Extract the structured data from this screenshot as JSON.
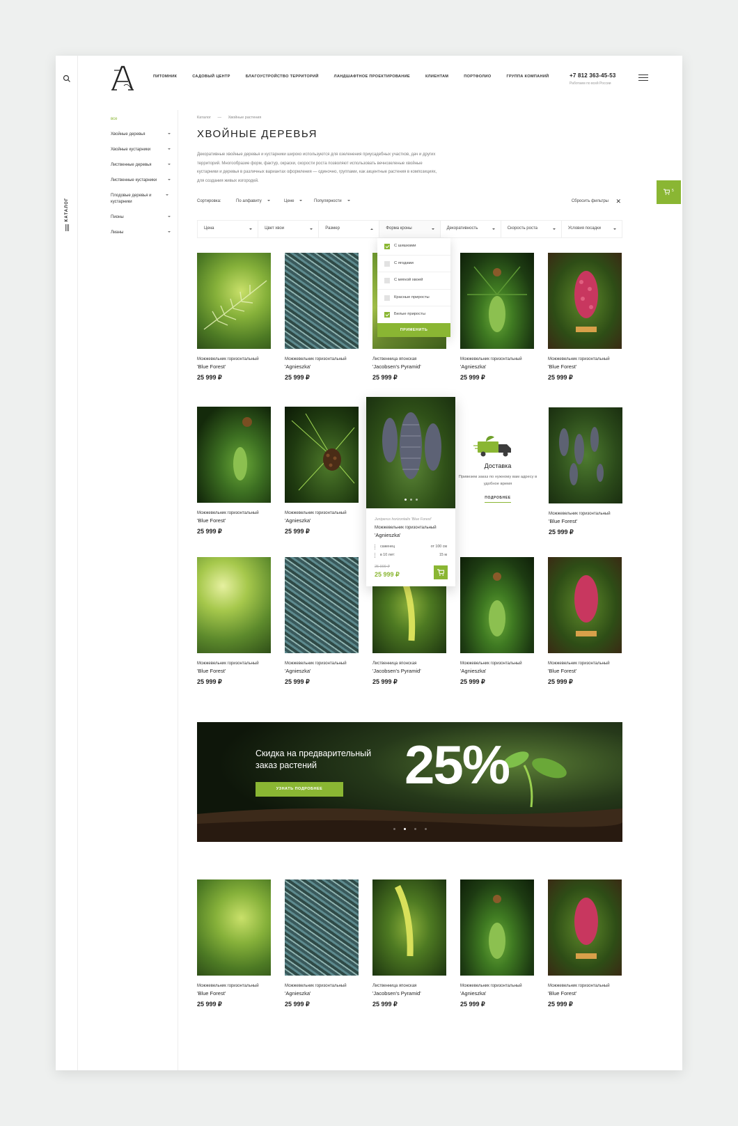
{
  "nav": {
    "items": [
      "ПИТОМНИК",
      "САДОВЫЙ ЦЕНТР",
      "БЛАГОУСТРОЙСТВО ТЕРРИТОРИЙ",
      "ЛАНДШАФТНОЕ ПРОЕКТИРОВАНИЕ",
      "КЛИЕНТАМ",
      "ПОРТФОЛИО",
      "ГРУППА КОМПАНИЙ"
    ],
    "phone": "+7 812 363-45-53",
    "phone_sub": "Работаем по всей России"
  },
  "rail": {
    "catalog_label": "КАТАЛОГ"
  },
  "sidebar": {
    "all": "все",
    "items": [
      "Хвойные деревья",
      "Хвойные кустарники",
      "Лиственные деревья",
      "Лиственные кустарники",
      "Плодовые деревья и кустарники",
      "Пионы",
      "Лианы"
    ]
  },
  "breadcrumb": {
    "root": "Каталог",
    "sep": "—",
    "current": "Хвойные растения"
  },
  "page": {
    "title": "ХВОЙНЫЕ ДЕРЕВЬЯ",
    "description": "Декоративные хвойные деревья и кустарники широко используются для озеленения приусадебных участков, дач и других территорий. Многообразие форм, фактур, окраски, скорости роста позволяют использовать вечнозеленые хвойные кустарники и деревья в различных вариантах оформления — одиночно, группами, как акцентные растения в композициях, для создания живых изгородей."
  },
  "sort": {
    "label": "Сортировка:",
    "options": [
      "По алфавиту",
      "Цене",
      "Популярности"
    ],
    "reset": "Сбросить фильтры",
    "reset_x": "✕"
  },
  "filters": [
    "Цена",
    "Цвет хвои",
    "Размер",
    "Форма кроны",
    "Декоративность",
    "Скорость роста",
    "Условия посадки"
  ],
  "dropdown": {
    "options": [
      {
        "label": "С шишками",
        "checked": true
      },
      {
        "label": "С ягодами",
        "checked": false
      },
      {
        "label": "С мягкой хвоей",
        "checked": false
      },
      {
        "label": "Красные приросты",
        "checked": false
      },
      {
        "label": "Белые приросты",
        "checked": true
      }
    ],
    "apply": "ПРИМЕНИТЬ"
  },
  "cart": {
    "count": "5"
  },
  "products": {
    "r1": [
      {
        "type": "Можжевельник горизонтальный",
        "name": "'Blue Forest'",
        "price": "25 999 ₽"
      },
      {
        "type": "Можжевельник горизонтальный",
        "name": "'Agnieszka'",
        "price": "25 999 ₽"
      },
      {
        "type": "Лиственница японская",
        "name": "'Jacobsen's Pyramid'",
        "price": "25 999 ₽"
      },
      {
        "type": "Можжевельник горизонтальный",
        "name": "'Agnieszka'",
        "price": "25 999 ₽"
      },
      {
        "type": "Можжевельник горизонтальный",
        "name": "'Blue Forest'",
        "price": "25 999 ₽"
      }
    ],
    "r2": [
      {
        "type": "Можжевельник горизонтальный",
        "name": "'Blue Forest'",
        "price": "25 999 ₽"
      },
      {
        "type": "Можжевельник горизонтальный",
        "name": "'Agnieszka'",
        "price": "25 999 ₽"
      },
      {
        "type": "Можжевельник горизонтальный",
        "name": "'Blue Forest'",
        "price": "25 999 ₽"
      }
    ],
    "r3": [
      {
        "type": "Можжевельник горизонтальный",
        "name": "'Blue Forest'",
        "price": "25 999 ₽"
      },
      {
        "type": "Можжевельник горизонтальный",
        "name": "'Agnieszka'",
        "price": "25 999 ₽"
      },
      {
        "type": "Лиственница японская",
        "name": "'Jacobsen's Pyramid'",
        "price": "25 999 ₽"
      },
      {
        "type": "Можжевельник горизонтальный",
        "name": "'Agnieszka'",
        "price": "25 999 ₽"
      },
      {
        "type": "Можжевельник горизонтальный",
        "name": "'Blue Forest'",
        "price": "25 999 ₽"
      }
    ],
    "r4": [
      {
        "type": "Можжевельник горизонтальный",
        "name": "'Blue Forest'",
        "price": "25 999 ₽"
      },
      {
        "type": "Можжевельник горизонтальный",
        "name": "'Agnieszka'",
        "price": "25 999 ₽"
      },
      {
        "type": "Лиственница японская",
        "name": "'Jacobsen's Pyramid'",
        "price": "25 999 ₽"
      },
      {
        "type": "Можжевельник горизонтальный",
        "name": "'Agnieszka'",
        "price": "25 999 ₽"
      },
      {
        "type": "Можжевельник горизонтальный",
        "name": "'Blue Forest'",
        "price": "25 999 ₽"
      }
    ]
  },
  "featured": {
    "latin": "Juniperus horizontalis 'Blue Forest'",
    "type": "Можжевельник горизонтальный",
    "name": "'Agnieszka'",
    "spec1_k": "саженец",
    "spec1_v": "от 100 см",
    "spec2_k": "в 10 лет:",
    "spec2_v": "15 м",
    "old_price": "25 999 ₽",
    "price": "25 999 ₽"
  },
  "delivery": {
    "title": "Доставка",
    "text": "Привезем заказ по нужному вам адресу в удобное время",
    "more": "ПОДРОБНЕЕ"
  },
  "banner": {
    "title": "Скидка на предварительный заказ растений",
    "button": "УЗНАТЬ ПОДРОБНЕЕ",
    "percent": "25%"
  },
  "colors": {
    "accent": "#8ab633"
  }
}
